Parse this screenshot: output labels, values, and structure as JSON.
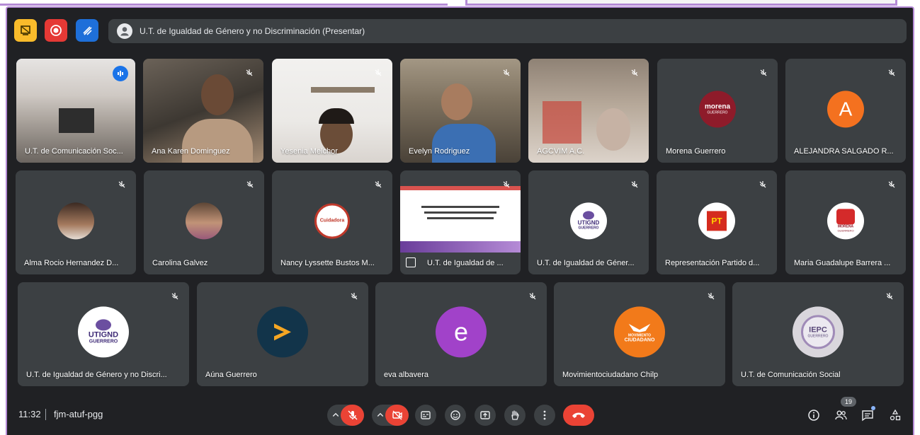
{
  "meeting": {
    "presentation_title": "U.T. de Igualdad de Género y no Discriminación (Presentar)",
    "time": "11:32",
    "separator": "|",
    "code": "fjm-atuf-pgg",
    "participants_count": "19"
  },
  "row1": [
    {
      "name": "U.T. de Comunicación Soc..."
    },
    {
      "name": "Ana Karen Dominguez"
    },
    {
      "name": "Yesenia Melchor"
    },
    {
      "name": "Evelyn Rodriguez"
    },
    {
      "name": "AGCVIM A.C."
    },
    {
      "name": "Morena Guerrero",
      "logo": "morena",
      "logo_sub": "GUERRERO"
    },
    {
      "name": "ALEJANDRA SALGADO R...",
      "initial": "A"
    }
  ],
  "row2": [
    {
      "name": "Alma Rocio Hernandez D..."
    },
    {
      "name": "Carolina Galvez"
    },
    {
      "name": "Nancy Lyssette Bustos M...",
      "logo": "Cuidadora"
    },
    {
      "name": "U.T. de Igualdad de ..."
    },
    {
      "name": "U.T. de Igualdad de Géner...",
      "logo": "UTIGND",
      "logo_sub": "GUERRERO"
    },
    {
      "name": "Representación Partido d...",
      "logo": "PT"
    },
    {
      "name": "Maria Guadalupe Barrera ...",
      "logo": "MORENA",
      "logo_sub": "GUERRERO"
    }
  ],
  "row3": [
    {
      "name": "U.T. de Igualdad de Género y no Discri...",
      "logo": "UTIGND",
      "logo_sub": "GUERRERO"
    },
    {
      "name": "Aúna Guerrero"
    },
    {
      "name": "eva albavera",
      "initial": "e"
    },
    {
      "name": "Movimientociudadano Chilp",
      "logo": "MOVIMIENTO",
      "logo_sub": "CIUDADANO"
    },
    {
      "name": "U.T. de Comunicación Social",
      "logo": "IEPC",
      "logo_sub": "GUERRERO"
    }
  ],
  "colors": {
    "background": "#202124",
    "tile": "#3c4043",
    "frame_border": "#b58bd6",
    "end_call": "#ea4335",
    "avatar_orange": "#f4711f",
    "avatar_purple": "#a142c9",
    "speaking": "#1a73e8"
  },
  "icons": {
    "top_left": [
      "whiteboard-icon",
      "record-icon",
      "annotate-icon"
    ],
    "controls": [
      "mic-off-icon",
      "camera-off-icon",
      "captions-icon",
      "emoji-icon",
      "present-icon",
      "raise-hand-icon",
      "more-options-icon",
      "end-call-icon"
    ],
    "right": [
      "info-icon",
      "people-icon",
      "chat-icon",
      "activities-icon"
    ]
  }
}
